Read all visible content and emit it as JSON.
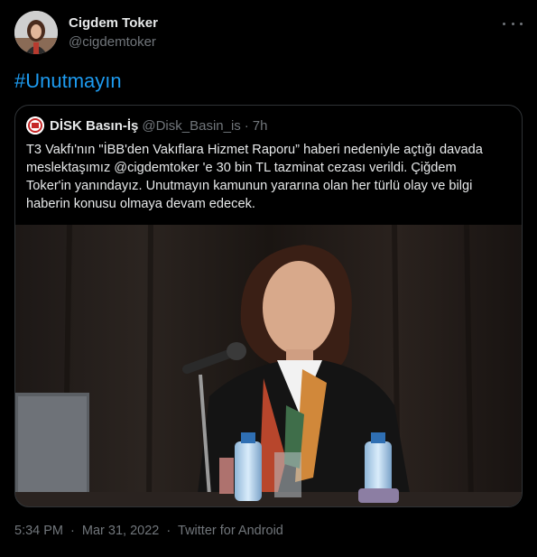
{
  "tweet": {
    "author_name": "Cigdem Toker",
    "author_handle": "@cigdemtoker",
    "more_icon": "more-horizontal-icon",
    "text": "#Unutmayın"
  },
  "quoted": {
    "name": "DİSK Basın-İş",
    "handle": "@Disk_Basin_is",
    "separator": "·",
    "time": "7h",
    "lines": [
      "T3 Vakfı'nın \"İBB'den Vakıflara Hizmet Raporu” haberi nedeniyle açtığı davada",
      "meslektaşımız @cigdemtoker 'e 30 bin TL tazminat cezası verildi.  Çiğdem",
      "Toker'in yanındayız. Unutmayın kamunun yararına olan her türlü olay ve bilgi",
      "haberin konusu olmaya devam edecek."
    ]
  },
  "meta": {
    "time": "5:34 PM",
    "sep1": "·",
    "date": "Mar 31, 2022",
    "sep2": "·",
    "source": "Twitter for Android"
  },
  "colors": {
    "background": "#000000",
    "text": "#e7e9ea",
    "secondary": "#71767b",
    "link": "#1d9bf0",
    "border": "#2f3336"
  }
}
